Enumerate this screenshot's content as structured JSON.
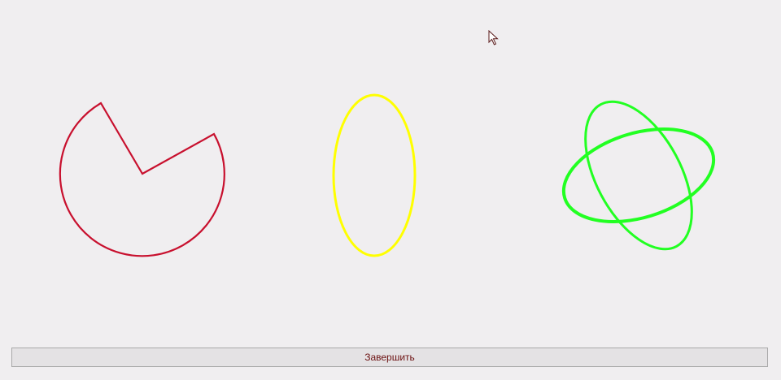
{
  "colors": {
    "background": "#f0eef0",
    "pie_shape": "#c8102e",
    "ellipse_shape": "#ffff00",
    "orbit_shape": "#22ff22",
    "button_text": "#6b1010"
  },
  "shapes": [
    {
      "name": "pie-sector",
      "icon": "pie-sector-icon"
    },
    {
      "name": "ellipse",
      "icon": "ellipse-icon"
    },
    {
      "name": "crossed-ellipses",
      "icon": "crossed-ellipses-icon"
    }
  ],
  "footer": {
    "finish_label": "Завершить"
  },
  "cursor": {
    "icon": "mouse-pointer-icon"
  }
}
